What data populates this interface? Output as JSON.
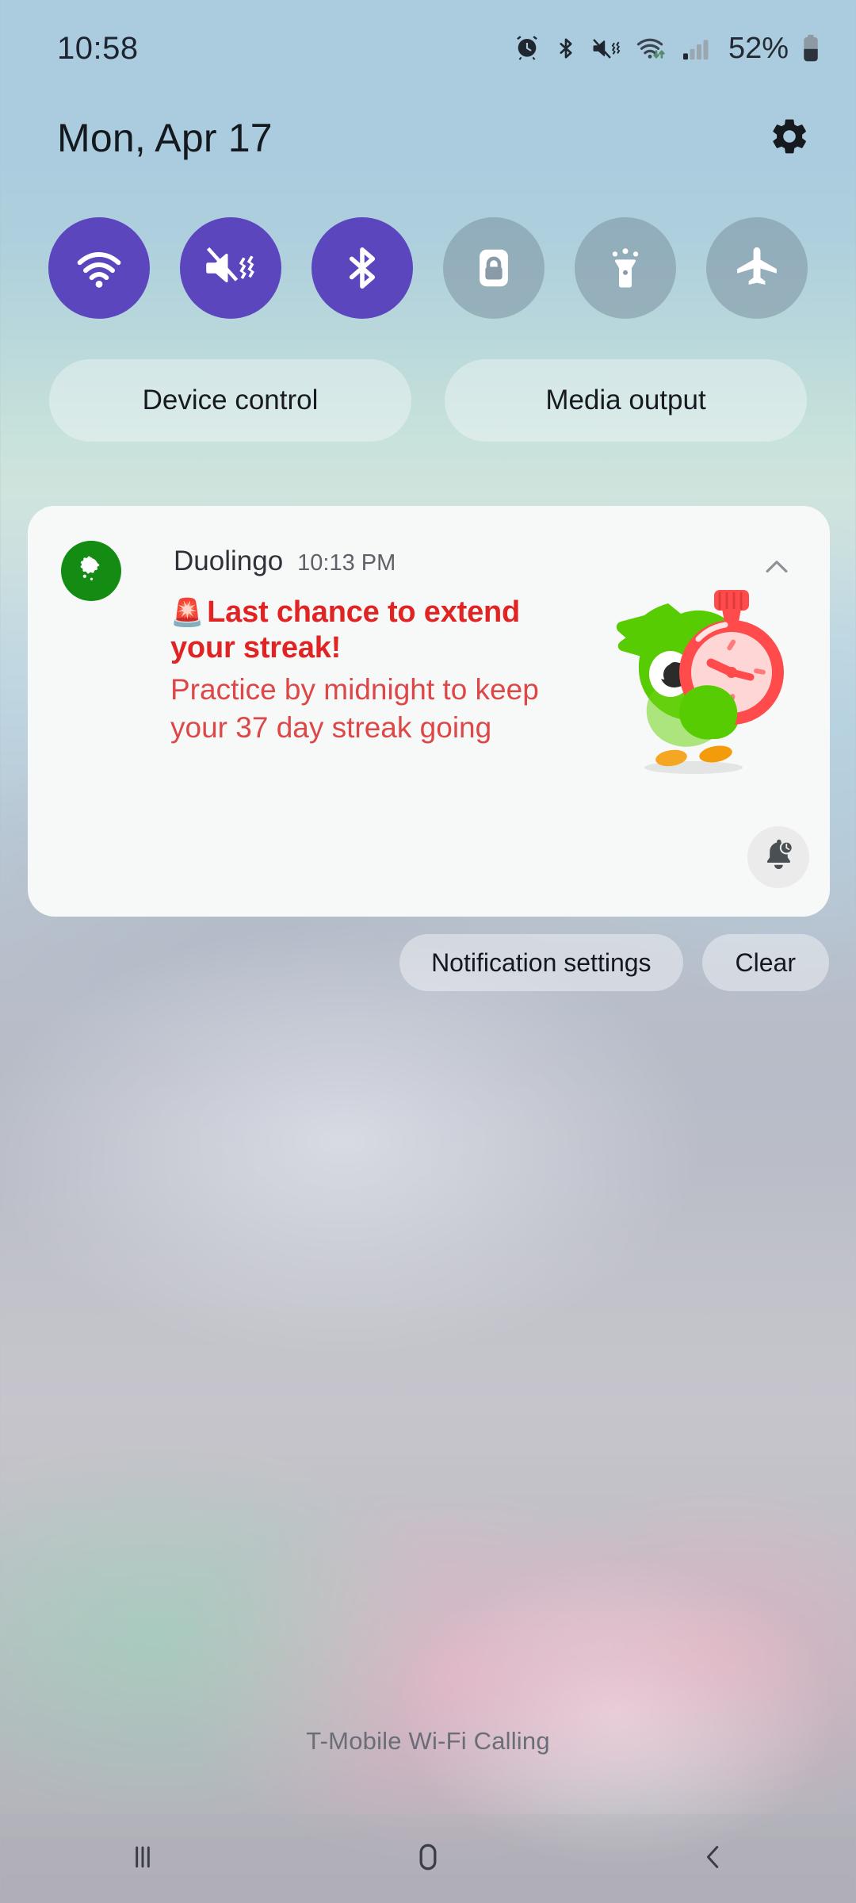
{
  "status_bar": {
    "clock": "10:58",
    "battery_percent": "52%",
    "icons": [
      "alarm-icon",
      "bluetooth-icon",
      "mute-vibrate-icon",
      "wifi-icon",
      "cellular-signal-icon",
      "battery-icon"
    ]
  },
  "panel_header": {
    "date": "Mon, Apr 17",
    "settings_icon": "gear-icon"
  },
  "quick_settings": {
    "tiles": [
      {
        "name": "wifi",
        "icon": "wifi-icon",
        "state": "on"
      },
      {
        "name": "sound-mode",
        "icon": "mute-vibrate-icon",
        "state": "on"
      },
      {
        "name": "bluetooth",
        "icon": "bluetooth-icon",
        "state": "on"
      },
      {
        "name": "auto-rotate",
        "icon": "rotation-lock-icon",
        "state": "off"
      },
      {
        "name": "flashlight",
        "icon": "flashlight-icon",
        "state": "off"
      },
      {
        "name": "airplane-mode",
        "icon": "airplane-icon",
        "state": "off"
      }
    ],
    "device_control_label": "Device control",
    "media_output_label": "Media output"
  },
  "notification": {
    "app_name": "Duolingo",
    "time": "10:13 PM",
    "emoji": "🚨",
    "title": "Last chance to extend your streak!",
    "body": "Practice by midnight to keep your 37 day streak going",
    "app_icon": "duolingo-owl-icon",
    "art": "duo-owl-with-stopwatch",
    "collapse_icon": "chevron-up-icon",
    "snooze_icon": "bell-clock-icon"
  },
  "actions": {
    "notification_settings_label": "Notification settings",
    "clear_label": "Clear"
  },
  "carrier": {
    "label": "T-Mobile Wi-Fi Calling"
  },
  "nav_bar": {
    "recents_icon": "recents-icon",
    "home_icon": "home-icon",
    "back_icon": "back-icon"
  },
  "colors": {
    "toggle_active": "#5b46be",
    "notification_accent": "#e02424",
    "duolingo_green": "#148c14",
    "card_background": "#f7f9f8"
  }
}
